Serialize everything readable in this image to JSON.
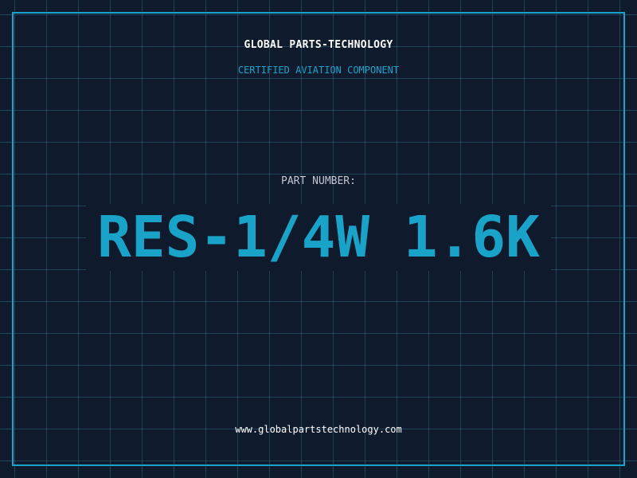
{
  "header": {
    "company_name": "GLOBAL PARTS-TECHNOLOGY",
    "subtitle": "CERTIFIED AVIATION COMPONENT"
  },
  "main": {
    "part_label": "PART NUMBER:",
    "part_number": "RES-1/4W 1.6K"
  },
  "footer": {
    "website": "www.globalpartstechnology.com"
  },
  "colors": {
    "background": "#101a2d",
    "accent": "#1aa3c9",
    "grid": "#2d607a",
    "text_primary": "#ffffff",
    "text_secondary": "#c2c7cf"
  }
}
